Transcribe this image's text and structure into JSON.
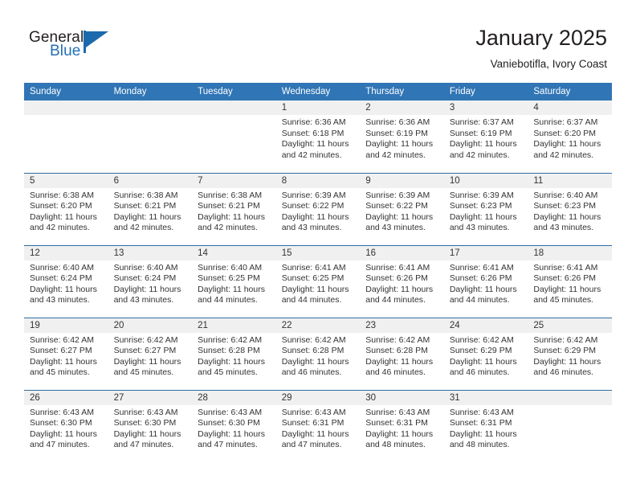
{
  "brand": {
    "name_top": "General",
    "name_bottom": "Blue",
    "flag_icon": "flag-triangle-icon",
    "accent_color": "#2470b8"
  },
  "header": {
    "title": "January 2025",
    "subtitle": "Vaniebotifla, Ivory Coast"
  },
  "theme": {
    "header_band": "#3075b5",
    "row_divider": "#2e6da4",
    "daynum_band": "#f0f0f0",
    "text": "#333333"
  },
  "calendar": {
    "month": "January",
    "year": "2025",
    "location": "Vaniebotifla, Ivory Coast",
    "weekday_headers": [
      "Sunday",
      "Monday",
      "Tuesday",
      "Wednesday",
      "Thursday",
      "Friday",
      "Saturday"
    ],
    "labels": {
      "sunrise": "Sunrise:",
      "sunset": "Sunset:",
      "daylight": "Daylight:"
    },
    "weeks": [
      [
        {
          "day": "",
          "empty": true
        },
        {
          "day": "",
          "empty": true
        },
        {
          "day": "",
          "empty": true
        },
        {
          "day": "1",
          "sunrise": "Sunrise: 6:36 AM",
          "sunset": "Sunset: 6:18 PM",
          "daylight_l1": "Daylight: 11 hours",
          "daylight_l2": "and 42 minutes."
        },
        {
          "day": "2",
          "sunrise": "Sunrise: 6:36 AM",
          "sunset": "Sunset: 6:19 PM",
          "daylight_l1": "Daylight: 11 hours",
          "daylight_l2": "and 42 minutes."
        },
        {
          "day": "3",
          "sunrise": "Sunrise: 6:37 AM",
          "sunset": "Sunset: 6:19 PM",
          "daylight_l1": "Daylight: 11 hours",
          "daylight_l2": "and 42 minutes."
        },
        {
          "day": "4",
          "sunrise": "Sunrise: 6:37 AM",
          "sunset": "Sunset: 6:20 PM",
          "daylight_l1": "Daylight: 11 hours",
          "daylight_l2": "and 42 minutes."
        }
      ],
      [
        {
          "day": "5",
          "sunrise": "Sunrise: 6:38 AM",
          "sunset": "Sunset: 6:20 PM",
          "daylight_l1": "Daylight: 11 hours",
          "daylight_l2": "and 42 minutes."
        },
        {
          "day": "6",
          "sunrise": "Sunrise: 6:38 AM",
          "sunset": "Sunset: 6:21 PM",
          "daylight_l1": "Daylight: 11 hours",
          "daylight_l2": "and 42 minutes."
        },
        {
          "day": "7",
          "sunrise": "Sunrise: 6:38 AM",
          "sunset": "Sunset: 6:21 PM",
          "daylight_l1": "Daylight: 11 hours",
          "daylight_l2": "and 42 minutes."
        },
        {
          "day": "8",
          "sunrise": "Sunrise: 6:39 AM",
          "sunset": "Sunset: 6:22 PM",
          "daylight_l1": "Daylight: 11 hours",
          "daylight_l2": "and 43 minutes."
        },
        {
          "day": "9",
          "sunrise": "Sunrise: 6:39 AM",
          "sunset": "Sunset: 6:22 PM",
          "daylight_l1": "Daylight: 11 hours",
          "daylight_l2": "and 43 minutes."
        },
        {
          "day": "10",
          "sunrise": "Sunrise: 6:39 AM",
          "sunset": "Sunset: 6:23 PM",
          "daylight_l1": "Daylight: 11 hours",
          "daylight_l2": "and 43 minutes."
        },
        {
          "day": "11",
          "sunrise": "Sunrise: 6:40 AM",
          "sunset": "Sunset: 6:23 PM",
          "daylight_l1": "Daylight: 11 hours",
          "daylight_l2": "and 43 minutes."
        }
      ],
      [
        {
          "day": "12",
          "sunrise": "Sunrise: 6:40 AM",
          "sunset": "Sunset: 6:24 PM",
          "daylight_l1": "Daylight: 11 hours",
          "daylight_l2": "and 43 minutes."
        },
        {
          "day": "13",
          "sunrise": "Sunrise: 6:40 AM",
          "sunset": "Sunset: 6:24 PM",
          "daylight_l1": "Daylight: 11 hours",
          "daylight_l2": "and 43 minutes."
        },
        {
          "day": "14",
          "sunrise": "Sunrise: 6:40 AM",
          "sunset": "Sunset: 6:25 PM",
          "daylight_l1": "Daylight: 11 hours",
          "daylight_l2": "and 44 minutes."
        },
        {
          "day": "15",
          "sunrise": "Sunrise: 6:41 AM",
          "sunset": "Sunset: 6:25 PM",
          "daylight_l1": "Daylight: 11 hours",
          "daylight_l2": "and 44 minutes."
        },
        {
          "day": "16",
          "sunrise": "Sunrise: 6:41 AM",
          "sunset": "Sunset: 6:26 PM",
          "daylight_l1": "Daylight: 11 hours",
          "daylight_l2": "and 44 minutes."
        },
        {
          "day": "17",
          "sunrise": "Sunrise: 6:41 AM",
          "sunset": "Sunset: 6:26 PM",
          "daylight_l1": "Daylight: 11 hours",
          "daylight_l2": "and 44 minutes."
        },
        {
          "day": "18",
          "sunrise": "Sunrise: 6:41 AM",
          "sunset": "Sunset: 6:26 PM",
          "daylight_l1": "Daylight: 11 hours",
          "daylight_l2": "and 45 minutes."
        }
      ],
      [
        {
          "day": "19",
          "sunrise": "Sunrise: 6:42 AM",
          "sunset": "Sunset: 6:27 PM",
          "daylight_l1": "Daylight: 11 hours",
          "daylight_l2": "and 45 minutes."
        },
        {
          "day": "20",
          "sunrise": "Sunrise: 6:42 AM",
          "sunset": "Sunset: 6:27 PM",
          "daylight_l1": "Daylight: 11 hours",
          "daylight_l2": "and 45 minutes."
        },
        {
          "day": "21",
          "sunrise": "Sunrise: 6:42 AM",
          "sunset": "Sunset: 6:28 PM",
          "daylight_l1": "Daylight: 11 hours",
          "daylight_l2": "and 45 minutes."
        },
        {
          "day": "22",
          "sunrise": "Sunrise: 6:42 AM",
          "sunset": "Sunset: 6:28 PM",
          "daylight_l1": "Daylight: 11 hours",
          "daylight_l2": "and 46 minutes."
        },
        {
          "day": "23",
          "sunrise": "Sunrise: 6:42 AM",
          "sunset": "Sunset: 6:28 PM",
          "daylight_l1": "Daylight: 11 hours",
          "daylight_l2": "and 46 minutes."
        },
        {
          "day": "24",
          "sunrise": "Sunrise: 6:42 AM",
          "sunset": "Sunset: 6:29 PM",
          "daylight_l1": "Daylight: 11 hours",
          "daylight_l2": "and 46 minutes."
        },
        {
          "day": "25",
          "sunrise": "Sunrise: 6:42 AM",
          "sunset": "Sunset: 6:29 PM",
          "daylight_l1": "Daylight: 11 hours",
          "daylight_l2": "and 46 minutes."
        }
      ],
      [
        {
          "day": "26",
          "sunrise": "Sunrise: 6:43 AM",
          "sunset": "Sunset: 6:30 PM",
          "daylight_l1": "Daylight: 11 hours",
          "daylight_l2": "and 47 minutes."
        },
        {
          "day": "27",
          "sunrise": "Sunrise: 6:43 AM",
          "sunset": "Sunset: 6:30 PM",
          "daylight_l1": "Daylight: 11 hours",
          "daylight_l2": "and 47 minutes."
        },
        {
          "day": "28",
          "sunrise": "Sunrise: 6:43 AM",
          "sunset": "Sunset: 6:30 PM",
          "daylight_l1": "Daylight: 11 hours",
          "daylight_l2": "and 47 minutes."
        },
        {
          "day": "29",
          "sunrise": "Sunrise: 6:43 AM",
          "sunset": "Sunset: 6:31 PM",
          "daylight_l1": "Daylight: 11 hours",
          "daylight_l2": "and 47 minutes."
        },
        {
          "day": "30",
          "sunrise": "Sunrise: 6:43 AM",
          "sunset": "Sunset: 6:31 PM",
          "daylight_l1": "Daylight: 11 hours",
          "daylight_l2": "and 48 minutes."
        },
        {
          "day": "31",
          "sunrise": "Sunrise: 6:43 AM",
          "sunset": "Sunset: 6:31 PM",
          "daylight_l1": "Daylight: 11 hours",
          "daylight_l2": "and 48 minutes."
        },
        {
          "day": "",
          "empty": true
        }
      ]
    ]
  }
}
